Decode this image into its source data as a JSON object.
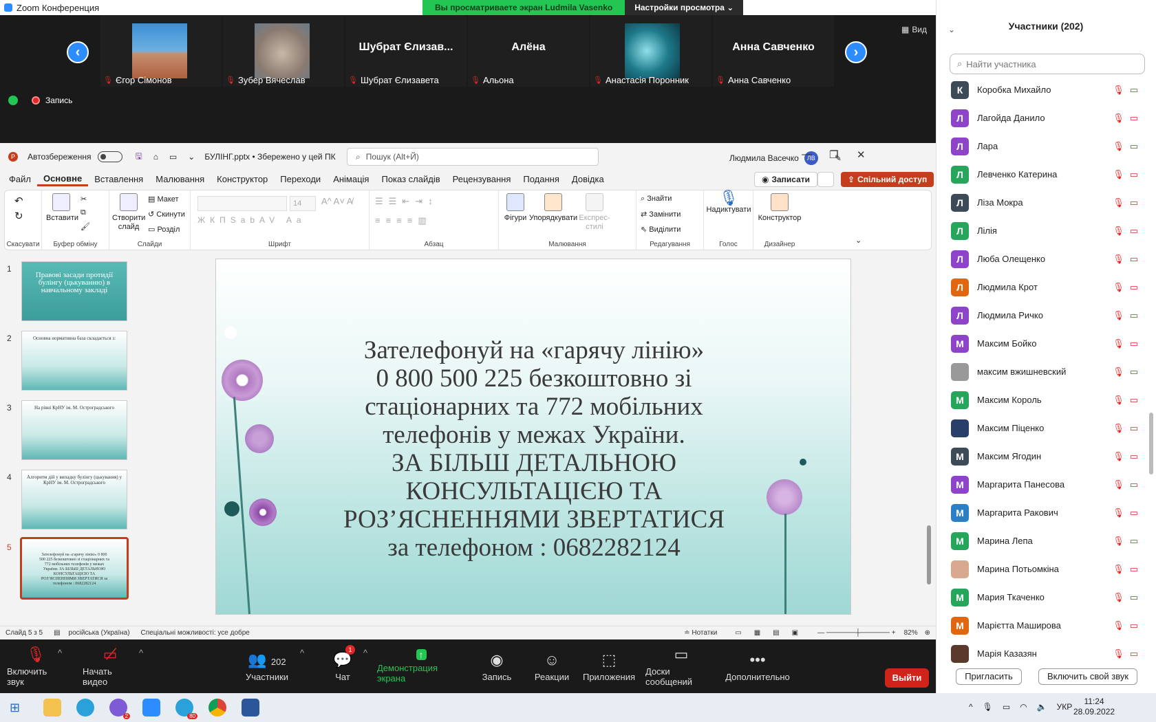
{
  "window_title": "Zoom Конференция",
  "share_banner": {
    "viewing": "Вы просматриваете экран Ludmila Vasenko",
    "settings": "Настройки просмотра"
  },
  "view_label": "Вид",
  "recording_label": "Запись",
  "video_tiles": [
    {
      "name": "Єгор Сімонов",
      "big": ""
    },
    {
      "name": "Зубер Вячеслав",
      "big": ""
    },
    {
      "name": "Шубрат Єлизавета",
      "big": "Шубрат Єлизав..."
    },
    {
      "name": "Альона",
      "big": "Алёна"
    },
    {
      "name": "Анастасія Поронник",
      "big": ""
    },
    {
      "name": "Анна Савченко",
      "big": "Анна Савченко"
    }
  ],
  "ppt": {
    "autosave": "Автозбереження",
    "filename": "БУЛІНГ.pptx • Збережено у цей ПК",
    "search_placeholder": "Пошук (Alt+Й)",
    "user": "Людмила Васечко",
    "user_initials": "ЛВ",
    "menu": [
      "Файл",
      "Основне",
      "Вставлення",
      "Малювання",
      "Конструктор",
      "Переходи",
      "Анімація",
      "Показ слайдів",
      "Рецензування",
      "Подання",
      "Довідка"
    ],
    "record_btn": "Записати",
    "share_btn": "Спільний доступ",
    "ribbon": {
      "undo_group": "Скасувати",
      "paste": "Вставити",
      "clipboard": "Буфер обміну",
      "new_slide": "Створити слайд",
      "layout": "Макет",
      "reset": "Скинути",
      "section": "Розділ",
      "slides": "Слайди",
      "font_size": "14",
      "font": "Шрифт",
      "paragraph": "Абзац",
      "shapes": "Фігури",
      "arrange": "Упорядкувати",
      "quick_styles": "Експрес-стилі",
      "drawing": "Малювання",
      "find": "Знайти",
      "replace": "Замінити",
      "select": "Виділити",
      "editing": "Редагування",
      "dictate": "Надиктувати",
      "voice": "Голос",
      "designer_btn": "Конструктор",
      "designer": "Дизайнер"
    },
    "thumbs": [
      {
        "num": "1",
        "text": "Правові засади протидії булінгу (цькуванню) в навчальному закладі"
      },
      {
        "num": "2",
        "text": "Основна нормативна база складається з:"
      },
      {
        "num": "3",
        "text": "На рівні КрНУ ім. М. Остроградського"
      },
      {
        "num": "4",
        "text": "Алгоритм дій у випадку булінгу (цькування) у КрНУ ім. М. Остроградського"
      },
      {
        "num": "5",
        "text": "Зателефонуй на «гарячу лінію» 0 800 500 225 безкоштовно зі стаціонарних та 772 мобільних телефонів у межах України. ЗА БІЛЬШ ДЕТАЛЬНОЮ КОНСУЛЬТАЦІЄЮ ТА РОЗ’ЯСНЕННЯМИ ЗВЕРТАТИСЯ за телефоном : 0682282124"
      }
    ],
    "slide_lines": [
      "Зателефонуй на «гарячу лінію»",
      "0 800 500 225 безкоштовно зі",
      "стаціонарних та 772 мобільних",
      "телефонів у межах України.",
      "ЗА БІЛЬШ ДЕТАЛЬНОЮ",
      "КОНСУЛЬТАЦІЄЮ ТА",
      "РОЗ’ЯСНЕННЯМИ ЗВЕРТАТИСЯ",
      "за телефоном : 0682282124"
    ],
    "status": {
      "slide": "Слайд 5 з 5",
      "lang": "російська (Україна)",
      "access": "Спеціальні можливості: усе добре",
      "notes": "Нотатки",
      "zoom": "82%"
    }
  },
  "participants": {
    "title": "Участники (202)",
    "search_placeholder": "Найти участника",
    "list": [
      {
        "initial": "К",
        "name": "Коробка Михайло",
        "color": "#3d4a57"
      },
      {
        "initial": "Л",
        "name": "Лагойда Данило",
        "color": "#8e44c9"
      },
      {
        "initial": "Л",
        "name": "Лара",
        "color": "#8e44c9"
      },
      {
        "initial": "Л",
        "name": "Левченко Катерина",
        "color": "#26a65b"
      },
      {
        "initial": "Л",
        "name": "Ліза Мокра",
        "color": "#3d4a57"
      },
      {
        "initial": "Л",
        "name": "Лілія",
        "color": "#26a65b"
      },
      {
        "initial": "Л",
        "name": "Люба Олещенко",
        "color": "#8e44c9"
      },
      {
        "initial": "Л",
        "name": "Людмила Крот",
        "color": "#e0660f"
      },
      {
        "initial": "Л",
        "name": "Людмила Ричко",
        "color": "#8e44c9"
      },
      {
        "initial": "М",
        "name": "Максим Бойко",
        "color": "#8e44c9"
      },
      {
        "initial": "",
        "name": "максим вжишневский",
        "color": "#999999"
      },
      {
        "initial": "М",
        "name": "Максим Король",
        "color": "#26a65b"
      },
      {
        "initial": "",
        "name": "Максим Піценко",
        "color": "#2a3e6a"
      },
      {
        "initial": "М",
        "name": "Максим Ягодин",
        "color": "#3d4a57"
      },
      {
        "initial": "М",
        "name": "Маргарита Панесова",
        "color": "#8e44c9"
      },
      {
        "initial": "М",
        "name": "Маргарита Ракович",
        "color": "#2b7fc4"
      },
      {
        "initial": "М",
        "name": "Марина Лепа",
        "color": "#26a65b"
      },
      {
        "initial": "",
        "name": "Марина Потьомкіна",
        "color": "#d9a890"
      },
      {
        "initial": "М",
        "name": "Мария Ткаченко",
        "color": "#26a65b"
      },
      {
        "initial": "М",
        "name": "Марієтта Маширова",
        "color": "#e0660f"
      },
      {
        "initial": "",
        "name": "Марія Казазян",
        "color": "#5a3a2a"
      }
    ],
    "invite": "Пригласить",
    "unmute_me": "Включить свой звук"
  },
  "toolbar": {
    "mute": "Включить звук",
    "video": "Начать видео",
    "participants": "Участники",
    "participants_count": "202",
    "chat": "Чат",
    "chat_badge": "1",
    "share": "Демонстрация экрана",
    "record": "Запись",
    "reactions": "Реакции",
    "apps": "Приложения",
    "whiteboard": "Доски сообщений",
    "more": "Дополнительно",
    "leave": "Выйти"
  },
  "taskbar": {
    "lang": "УКР",
    "time": "11:24",
    "date": "28.09.2022",
    "viber_badge": "2",
    "telegram_badge": "80"
  }
}
